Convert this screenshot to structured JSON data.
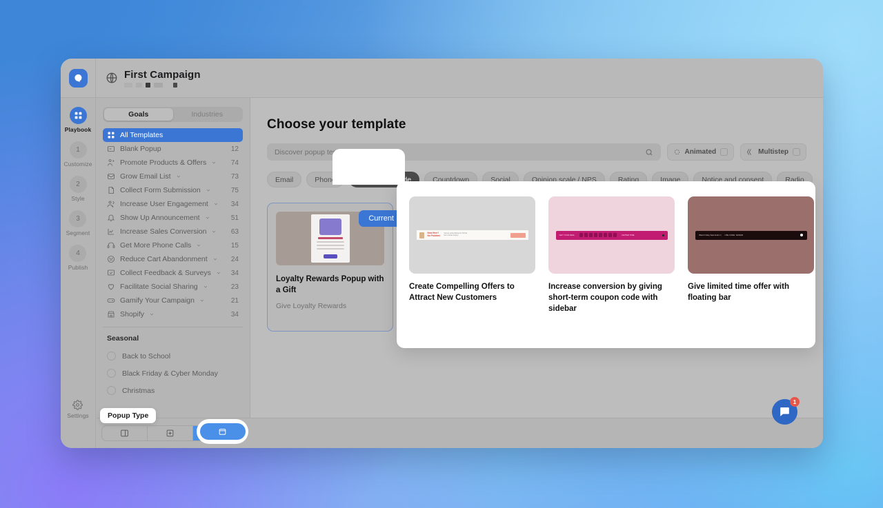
{
  "header": {
    "campaign_title": "First Campaign",
    "logo_icon": "brand-logo-icon",
    "globe_icon": "globe-icon"
  },
  "rail": {
    "items": [
      {
        "badge": "",
        "label": "Playbook",
        "icon": "grid-icon",
        "active": true
      },
      {
        "badge": "1",
        "label": "Customize",
        "active": false
      },
      {
        "badge": "2",
        "label": "Style",
        "active": false
      },
      {
        "badge": "3",
        "label": "Segment",
        "active": false
      },
      {
        "badge": "4",
        "label": "Publish",
        "active": false
      }
    ],
    "settings_label": "Settings",
    "settings_icon": "gear-icon",
    "briefcase_icon": "briefcase-icon"
  },
  "sidebar": {
    "tabs": [
      {
        "label": "Goals",
        "selected": true
      },
      {
        "label": "Industries",
        "selected": false
      }
    ],
    "categories": [
      {
        "label": "All Templates",
        "count": "",
        "icon": "grid-icon",
        "chevron": false,
        "selected": true
      },
      {
        "label": "Blank Popup",
        "count": "12",
        "icon": "blank-popup-icon",
        "chevron": false,
        "selected": false
      },
      {
        "label": "Promote Products & Offers",
        "count": "74",
        "icon": "megaphone-person-icon",
        "chevron": true,
        "selected": false
      },
      {
        "label": "Grow Email List",
        "count": "73",
        "icon": "envelope-icon",
        "chevron": true,
        "selected": false
      },
      {
        "label": "Collect Form Submission",
        "count": "75",
        "icon": "form-icon",
        "chevron": true,
        "selected": false
      },
      {
        "label": "Increase User Engagement",
        "count": "34",
        "icon": "people-icon",
        "chevron": true,
        "selected": false
      },
      {
        "label": "Show Up Announcement",
        "count": "51",
        "icon": "bell-icon",
        "chevron": true,
        "selected": false
      },
      {
        "label": "Increase Sales Conversion",
        "count": "63",
        "icon": "chart-line-icon",
        "chevron": true,
        "selected": false
      },
      {
        "label": "Get More Phone Calls",
        "count": "15",
        "icon": "headset-icon",
        "chevron": true,
        "selected": false
      },
      {
        "label": "Reduce Cart Abandonment",
        "count": "24",
        "icon": "sad-face-icon",
        "chevron": true,
        "selected": false
      },
      {
        "label": "Collect Feedback & Surveys",
        "count": "34",
        "icon": "checkbox-square-icon",
        "chevron": true,
        "selected": false
      },
      {
        "label": "Facilitate Social Sharing",
        "count": "23",
        "icon": "heart-icon",
        "chevron": true,
        "selected": false
      },
      {
        "label": "Gamify Your Campaign",
        "count": "21",
        "icon": "game-controller-icon",
        "chevron": true,
        "selected": false
      },
      {
        "label": "Shopify",
        "count": "34",
        "icon": "shop-icon",
        "chevron": true,
        "selected": false
      }
    ],
    "seasonal_heading": "Seasonal",
    "seasonal": [
      {
        "label": "Back to School"
      },
      {
        "label": "Black Friday & Cyber Monday"
      },
      {
        "label": "Christmas"
      }
    ]
  },
  "main": {
    "title": "Choose your template",
    "search": {
      "placeholder": "Discover popup templates",
      "value": "",
      "icon": "search-icon"
    },
    "toggles": [
      {
        "label": "Animated",
        "icon": "animated-icon",
        "checked": false
      },
      {
        "label": "Multistep",
        "icon": "multistep-icon",
        "checked": false
      }
    ],
    "chips": [
      {
        "label": "Email",
        "selected": false
      },
      {
        "label": "Phone",
        "selected": false
      },
      {
        "label": "Coupon code",
        "selected": true,
        "icon": "check-icon"
      },
      {
        "label": "Countdown",
        "selected": false
      },
      {
        "label": "Social",
        "selected": false
      },
      {
        "label": "Opinion scale / NPS",
        "selected": false
      },
      {
        "label": "Rating",
        "selected": false
      },
      {
        "label": "Image",
        "selected": false
      },
      {
        "label": "Notice and consent",
        "selected": false
      },
      {
        "label": "Radio",
        "selected": false
      }
    ],
    "current_card": {
      "badge": "Current",
      "title": "Loyalty Rewards Popup with a Gift",
      "subtitle": "Give Loyalty Rewards"
    },
    "templates": [
      {
        "title": "Create Compelling Offers to Attract New Customers",
        "thumb_class": "g1"
      },
      {
        "title": "Increase conversion by giving short-term coupon code with sidebar",
        "thumb_class": "g2"
      },
      {
        "title": "Give limited time offer with floating bar",
        "thumb_class": "g3"
      }
    ]
  },
  "bottom": {
    "tooltip": "Popup Type",
    "buttons": [
      {
        "icon": "sidebar-layout-icon",
        "selected": false
      },
      {
        "icon": "fullscreen-layout-icon",
        "selected": false
      },
      {
        "icon": "popup-layout-icon",
        "selected": true
      }
    ]
  },
  "chat": {
    "badge_count": "1",
    "icon": "chat-bubble-icon"
  },
  "colors": {
    "accent_blue": "#3b76d4",
    "chip_dark": "#4a4a4a",
    "badge_red": "#e8564a",
    "toolbar_blue": "#4a90e8"
  }
}
